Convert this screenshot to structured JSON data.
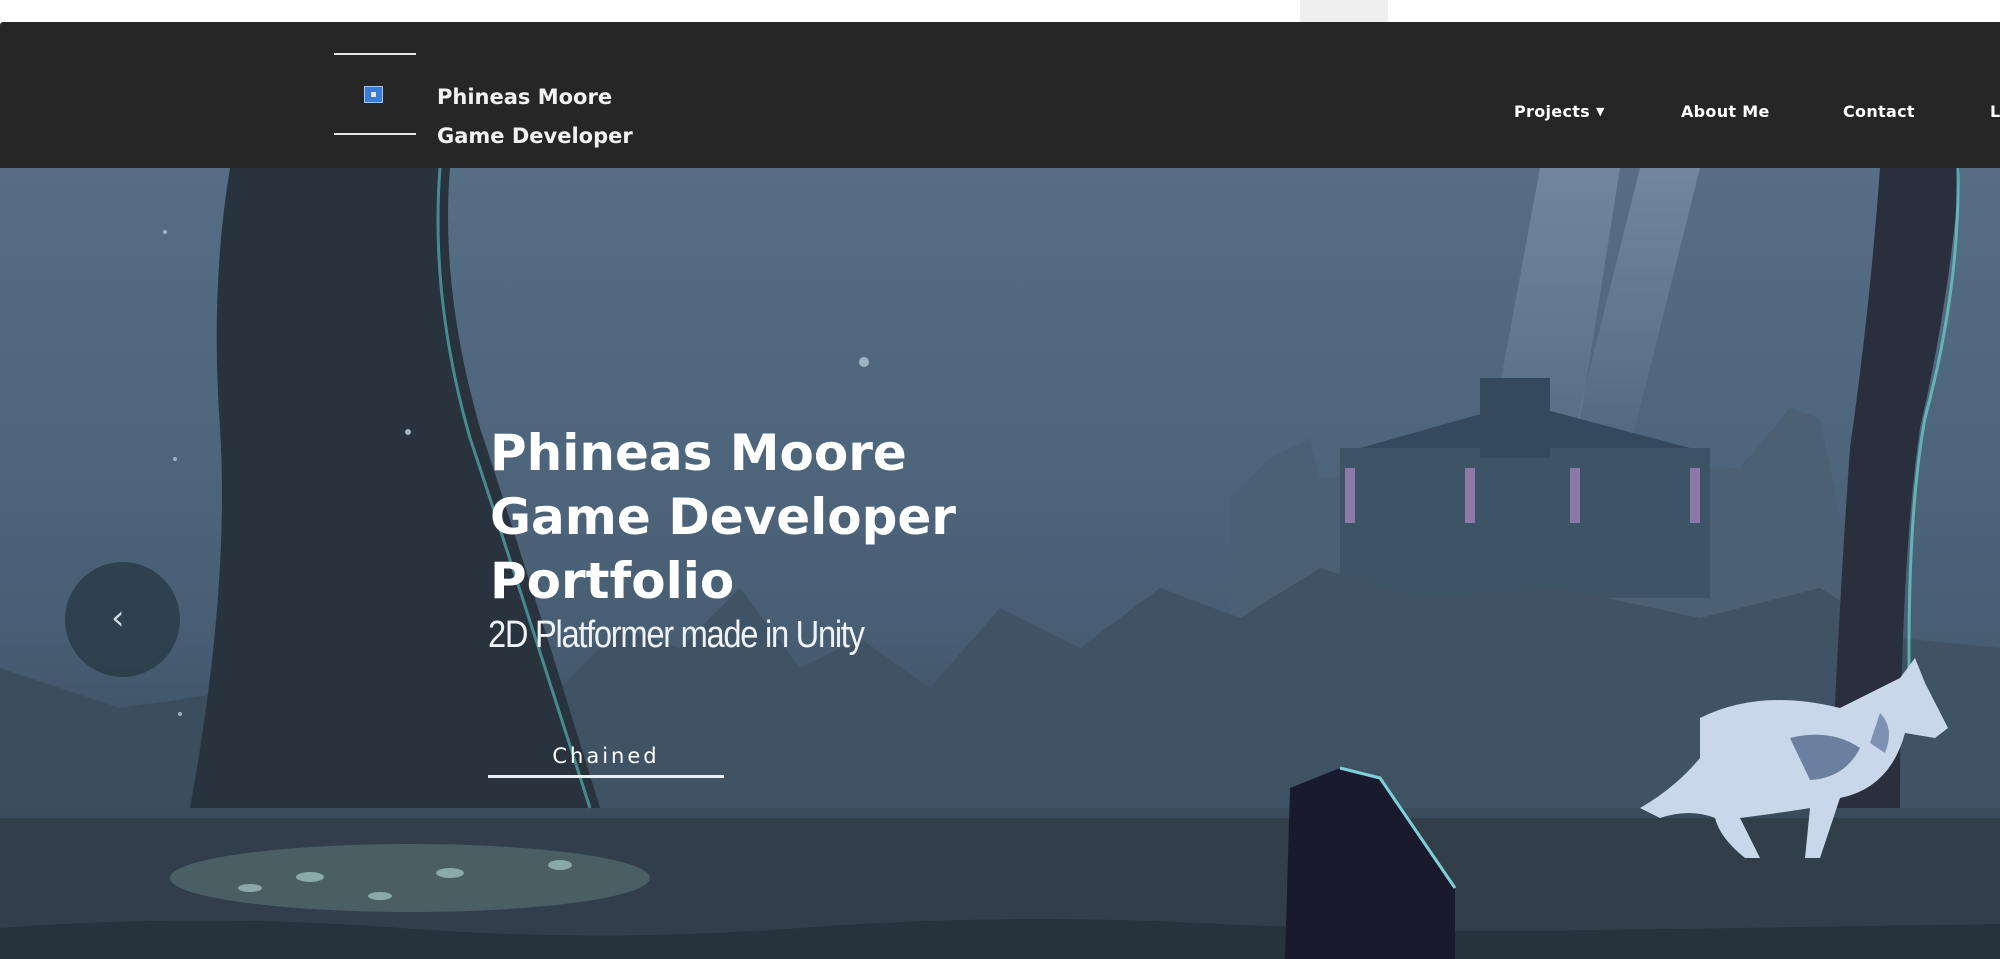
{
  "navbar": {
    "brand_line1": "Phineas Moore",
    "brand_line2": "Game Developer",
    "logo_icon": "game-logo-icon",
    "links": [
      {
        "label": "Projects",
        "has_dropdown": true
      },
      {
        "label": "About Me"
      },
      {
        "label": "Contact"
      },
      {
        "label": "L"
      }
    ]
  },
  "hero": {
    "title_lines": [
      "Phineas Moore",
      "Game Developer",
      "Portfolio"
    ],
    "subtitle": "2D Platformer made in Unity",
    "button_label": "Chained",
    "prev_icon": "chevron-left-icon"
  },
  "colors": {
    "navbar_bg": "#262626",
    "hero_sky": "#566e85",
    "text": "#ffffff"
  }
}
